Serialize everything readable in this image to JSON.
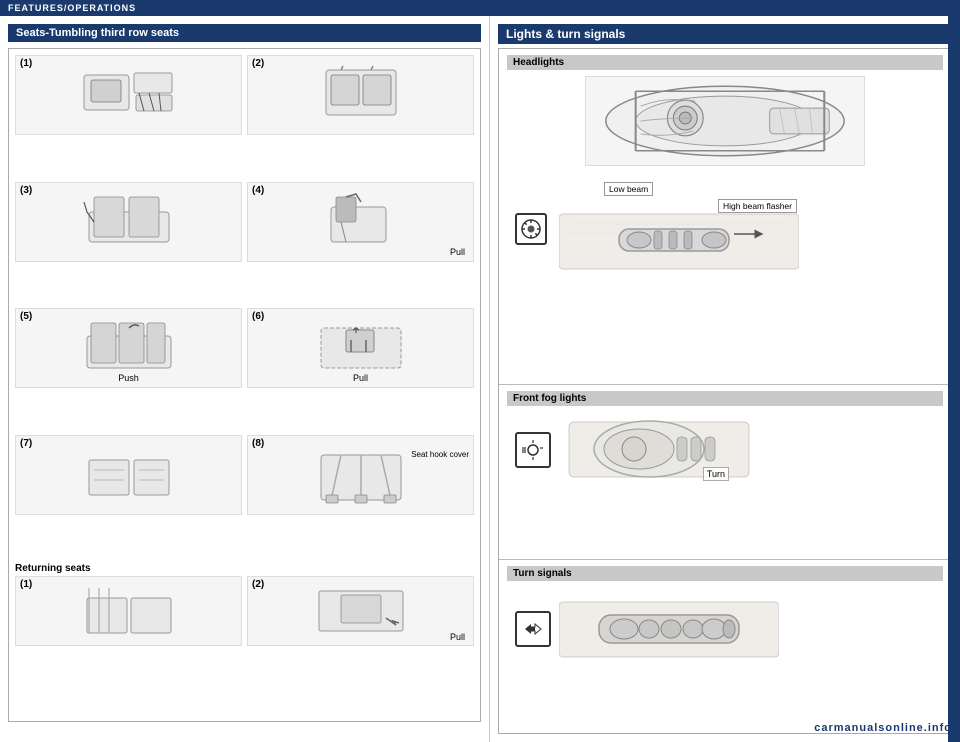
{
  "header": {
    "label": "FEATURES/OPERATIONS"
  },
  "left_panel": {
    "section_title": "Seats-Tumbling third row seats",
    "steps": [
      {
        "num": "(1)",
        "label": ""
      },
      {
        "num": "(2)",
        "label": ""
      },
      {
        "num": "(3)",
        "label": ""
      },
      {
        "num": "(4)",
        "label": "Pull"
      },
      {
        "num": "(5)",
        "label": "Push"
      },
      {
        "num": "(6)",
        "label": "Pull"
      },
      {
        "num": "(7)",
        "label": ""
      },
      {
        "num": "(8)",
        "label": "Seat hook cover"
      }
    ],
    "returning_label": "Returning seats",
    "returning_steps": [
      {
        "num": "(1)",
        "label": ""
      },
      {
        "num": "(2)",
        "label": "Pull"
      }
    ]
  },
  "right_panel": {
    "section_title": "Lights & turn signals",
    "subsections": [
      {
        "title": "Headlights",
        "annotations": {
          "low_beam": "Low beam",
          "high_beam_flasher": "High beam flasher"
        }
      },
      {
        "title": "Front fog lights",
        "annotations": {
          "turn": "Turn"
        }
      },
      {
        "title": "Turn signals",
        "annotations": {}
      }
    ]
  },
  "watermark": "carmanualsonline.info",
  "icons": {
    "headlight_switch": "☀",
    "fog_switch": "🌫",
    "turn_switch": "↔"
  }
}
